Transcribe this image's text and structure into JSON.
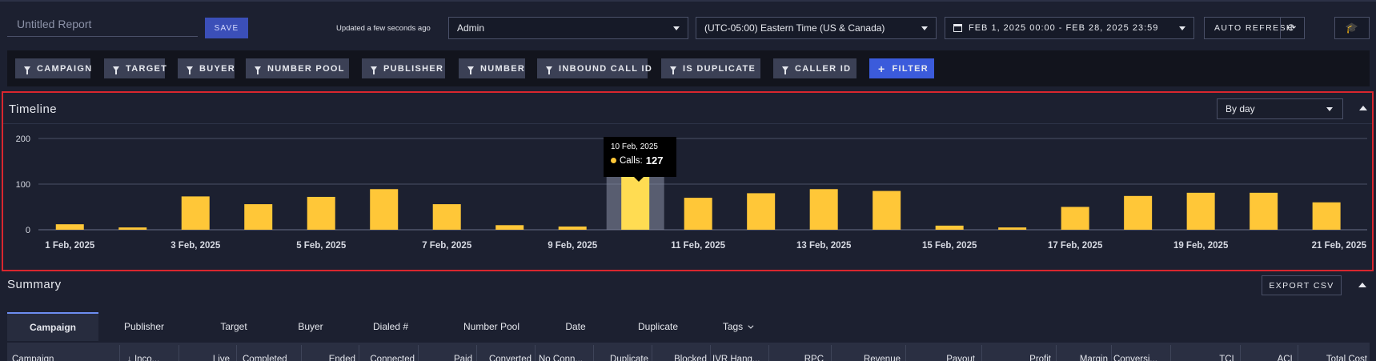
{
  "header": {
    "report_title": "Untitled Report",
    "save_label": "SAVE",
    "updated_text": "Updated a few seconds ago",
    "user_select": "Admin",
    "timezone_select": "(UTC-05:00) Eastern Time (US & Canada)",
    "date_range": "FEB 1, 2025 00:00 - FEB 28, 2025 23:59",
    "auto_refresh_label": "AUTO REFRESH",
    "refresh_icon": "refresh-icon",
    "graduation_icon": "graduation-cap-icon"
  },
  "filters": {
    "chips": [
      "CAMPAIGN",
      "TARGET",
      "BUYER",
      "NUMBER POOL",
      "PUBLISHER",
      "NUMBER",
      "INBOUND CALL ID",
      "IS DUPLICATE",
      "CALLER ID"
    ],
    "add_label": "FILTER"
  },
  "timeline": {
    "title": "Timeline",
    "granularity": "By day",
    "tooltip": {
      "date": "10 Feb, 2025",
      "series_label": "Calls:",
      "value": "127"
    }
  },
  "chart_data": {
    "type": "bar",
    "title": "Timeline",
    "series": [
      {
        "name": "Calls",
        "color": "#ffc738",
        "values": [
          12,
          5,
          73,
          56,
          72,
          89,
          56,
          10,
          7,
          127,
          70,
          80,
          89,
          85,
          9,
          5,
          50,
          74,
          81,
          81,
          60
        ]
      }
    ],
    "categories": [
      "1 Feb, 2025",
      "2 Feb, 2025",
      "3 Feb, 2025",
      "4 Feb, 2025",
      "5 Feb, 2025",
      "6 Feb, 2025",
      "7 Feb, 2025",
      "8 Feb, 2025",
      "9 Feb, 2025",
      "10 Feb, 2025",
      "11 Feb, 2025",
      "12 Feb, 2025",
      "13 Feb, 2025",
      "14 Feb, 2025",
      "15 Feb, 2025",
      "16 Feb, 2025",
      "17 Feb, 2025",
      "18 Feb, 2025",
      "19 Feb, 2025",
      "20 Feb, 2025",
      "21 Feb, 2025"
    ],
    "x_tick_labels": [
      "1 Feb, 2025",
      "3 Feb, 2025",
      "5 Feb, 2025",
      "7 Feb, 2025",
      "9 Feb, 2025",
      "11 Feb, 2025",
      "13 Feb, 2025",
      "15 Feb, 2025",
      "17 Feb, 2025",
      "19 Feb, 2025",
      "21 Feb, 2025"
    ],
    "y_ticks": [
      0,
      100,
      200
    ],
    "ylim": [
      0,
      200
    ],
    "highlighted_category": "10 Feb, 2025",
    "grid": true,
    "legend": "none"
  },
  "summary": {
    "title": "Summary",
    "export_label": "EXPORT CSV",
    "tabs": [
      "Campaign",
      "Publisher",
      "Target",
      "Buyer",
      "Dialed #",
      "Number Pool",
      "Date",
      "Duplicate",
      "Tags"
    ],
    "active_tab": "Campaign",
    "columns": [
      "Campaign",
      "↓ Inco...",
      "Live",
      "Completed",
      "Ended",
      "Connected",
      "Paid",
      "Converted",
      "No Conn...",
      "Duplicate",
      "Blocked",
      "IVR Hang...",
      "RPC",
      "Revenue",
      "Payout",
      "Profit",
      "Margin",
      "Conversi...",
      "TCL",
      "ACL",
      "Total Cost"
    ]
  }
}
